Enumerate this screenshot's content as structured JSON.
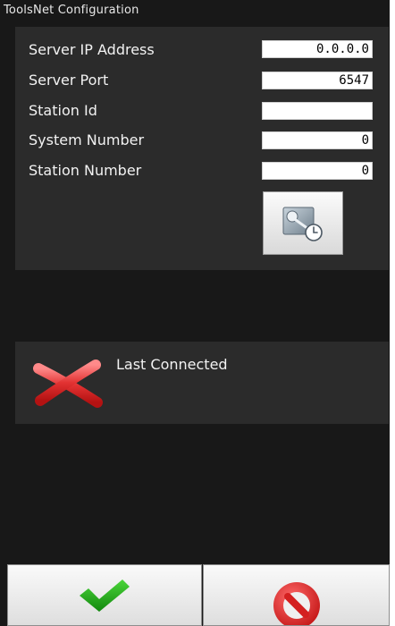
{
  "window": {
    "title": "ToolsNet Configuration"
  },
  "config": {
    "server_ip": {
      "label": "Server IP Address",
      "value": "0.0.0.0"
    },
    "server_port": {
      "label": "Server Port",
      "value": "6547"
    },
    "station_id": {
      "label": "Station Id",
      "value": ""
    },
    "system_number": {
      "label": "System Number",
      "value": "0"
    },
    "station_number": {
      "label": "Station Number",
      "value": "0"
    },
    "sync_button_icon": "time-sync-icon"
  },
  "status": {
    "icon": "red-x-icon",
    "label": "Last Connected"
  },
  "footer": {
    "ok_icon": "green-checkmark-icon",
    "cancel_icon": "red-no-icon"
  },
  "colors": {
    "background": "#181818",
    "panel": "#2b2b2b",
    "ok_green": "#22b21c",
    "cancel_red": "#e02a2a"
  }
}
